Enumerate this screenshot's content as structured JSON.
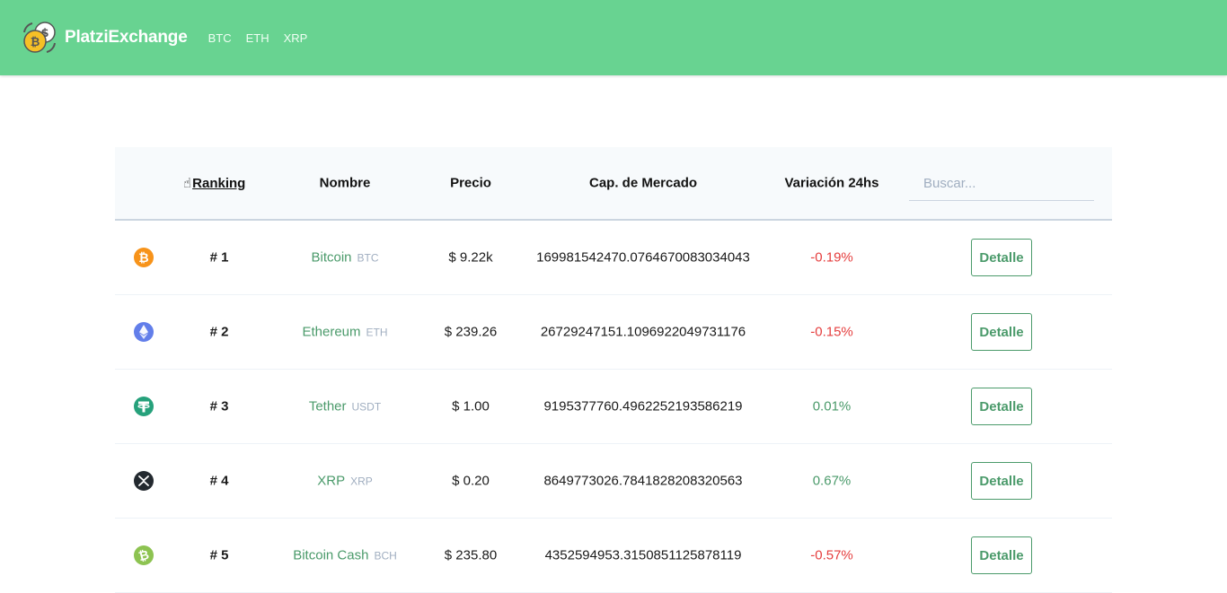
{
  "header": {
    "brand": "PlatziExchange",
    "nav": [
      "BTC",
      "ETH",
      "XRP"
    ],
    "bg_color": "#68d391"
  },
  "table": {
    "headers": {
      "ranking": "Ranking",
      "ranking_icon": "☝",
      "nombre": "Nombre",
      "precio": "Precio",
      "cap": "Cap. de Mercado",
      "variacion": "Variación 24hs"
    },
    "search_placeholder": "Buscar...",
    "button_label": "Detalle",
    "rows": [
      {
        "icon": "bitcoin-icon",
        "rank": "# 1",
        "name": "Bitcoin",
        "symbol": "BTC",
        "price": "$ 9.22k",
        "cap": "169981542470.0764670083034043",
        "change": "-0.19%"
      },
      {
        "icon": "ethereum-icon",
        "rank": "# 2",
        "name": "Ethereum",
        "symbol": "ETH",
        "price": "$ 239.26",
        "cap": "26729247151.1096922049731176",
        "change": "-0.15%"
      },
      {
        "icon": "tether-icon",
        "rank": "# 3",
        "name": "Tether",
        "symbol": "USDT",
        "price": "$ 1.00",
        "cap": "9195377760.4962252193586219",
        "change": "0.01%"
      },
      {
        "icon": "xrp-icon",
        "rank": "# 4",
        "name": "XRP",
        "symbol": "XRP",
        "price": "$ 0.20",
        "cap": "8649773026.7841828208320563",
        "change": "0.67%"
      },
      {
        "icon": "bitcoin-cash-icon",
        "rank": "# 5",
        "name": "Bitcoin Cash",
        "symbol": "BCH",
        "price": "$ 235.80",
        "cap": "4352594953.3150851125878119",
        "change": "-0.57%"
      }
    ]
  },
  "colors": {
    "positive": "#4a9a6a",
    "negative": "#e53e3e",
    "bitcoin": "#f7931a",
    "ethereum": "#627eea",
    "tether": "#26a17b",
    "xrp": "#23292f",
    "bitcoin_cash": "#8dc351"
  }
}
